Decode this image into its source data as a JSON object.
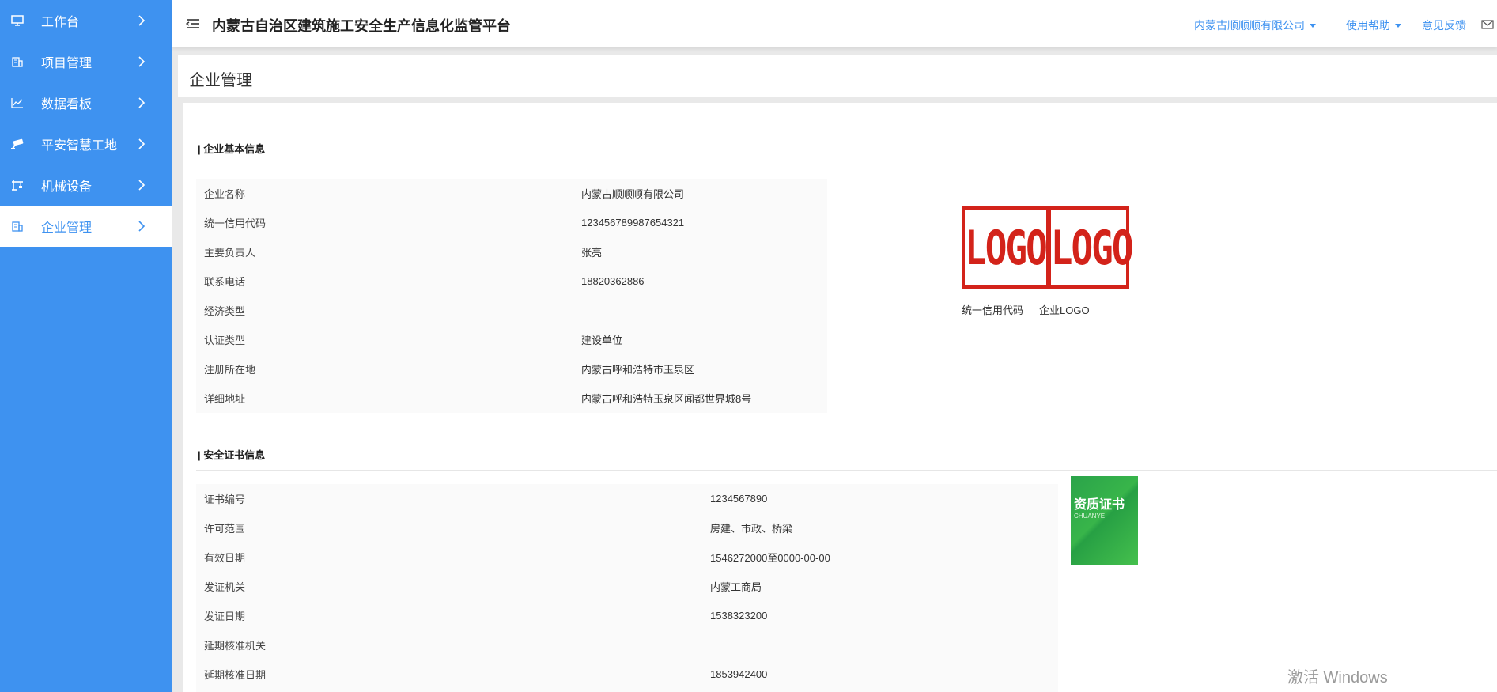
{
  "sidebar": {
    "items": [
      {
        "label": "工作台",
        "icon": "monitor-icon"
      },
      {
        "label": "项目管理",
        "icon": "building-icon"
      },
      {
        "label": "数据看板",
        "icon": "chart-icon"
      },
      {
        "label": "平安智慧工地",
        "icon": "camera-icon"
      },
      {
        "label": "机械设备",
        "icon": "crane-icon"
      },
      {
        "label": "企业管理",
        "icon": "building-icon",
        "active": true
      }
    ]
  },
  "header": {
    "title": "内蒙古自治区建筑施工安全生产信息化监管平台",
    "company": "内蒙古顺顺顺有限公司",
    "help": "使用帮助",
    "feedback": "意见反馈"
  },
  "page": {
    "title": "企业管理"
  },
  "basic": {
    "section_title": "| 企业基本信息",
    "rows": [
      {
        "label": "企业名称",
        "value": "内蒙古顺顺顺有限公司"
      },
      {
        "label": "统一信用代码",
        "value": "123456789987654321"
      },
      {
        "label": "主要负责人",
        "value": "张亮"
      },
      {
        "label": "联系电话",
        "value": "18820362886"
      },
      {
        "label": "经济类型",
        "value": ""
      },
      {
        "label": "认证类型",
        "value": "建设单位"
      },
      {
        "label": "注册所在地",
        "value": "内蒙古呼和浩特市玉泉区"
      },
      {
        "label": "详细地址",
        "value": "内蒙古呼和浩特玉泉区闻都世界城8号"
      }
    ],
    "logo_text_left": "LOGO",
    "logo_text_right": "LOGO",
    "caption_code": "统一信用代码",
    "caption_logo": "企业LOGO"
  },
  "cert": {
    "section_title": "| 安全证书信息",
    "rows": [
      {
        "label": "证书编号",
        "value": "1234567890"
      },
      {
        "label": "许可范围",
        "value": "房建、市政、桥梁"
      },
      {
        "label": "有效日期",
        "value": "1546272000至0000-00-00"
      },
      {
        "label": "发证机关",
        "value": "内蒙工商局"
      },
      {
        "label": "发证日期",
        "value": "1538323200"
      },
      {
        "label": "延期核准机关",
        "value": ""
      },
      {
        "label": "延期核准日期",
        "value": "1853942400"
      }
    ],
    "image_title": "资质证书",
    "image_sub": "CHUANYE"
  },
  "watermark": "激活 Windows",
  "colors": {
    "primary": "#3e92f0",
    "logo_red": "#d3231a",
    "cert_green": "#2aa34a"
  }
}
